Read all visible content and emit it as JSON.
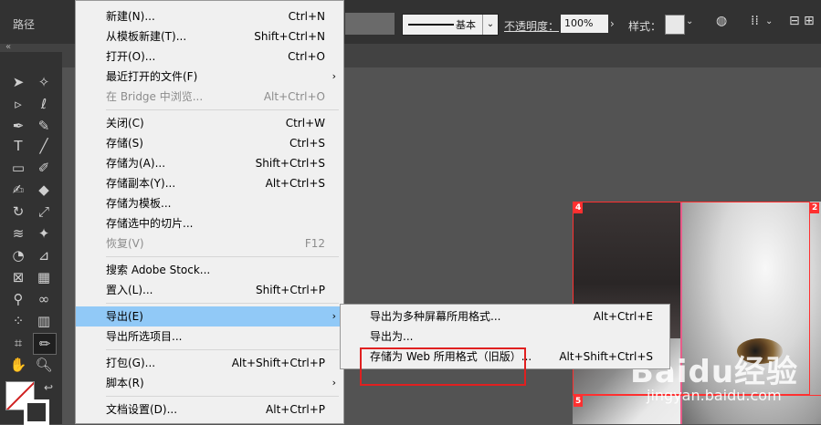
{
  "topbar": {
    "title": "路径",
    "stroke_label": "基本",
    "opacity_label": "不透明度：",
    "opacity_value": "100%",
    "style_label": "样式："
  },
  "file_menu": [
    {
      "label": "新建(N)...",
      "shortcut": "Ctrl+N"
    },
    {
      "label": "从模板新建(T)...",
      "shortcut": "Shift+Ctrl+N"
    },
    {
      "label": "打开(O)...",
      "shortcut": "Ctrl+O"
    },
    {
      "label": "最近打开的文件(F)",
      "shortcut": "",
      "arrow": "›"
    },
    {
      "label": "在 Bridge 中浏览...",
      "shortcut": "Alt+Ctrl+O"
    },
    {
      "label": "关闭(C)",
      "shortcut": "Ctrl+W"
    },
    {
      "label": "存储(S)",
      "shortcut": "Ctrl+S"
    },
    {
      "label": "存储为(A)...",
      "shortcut": "Shift+Ctrl+S"
    },
    {
      "label": "存储副本(Y)...",
      "shortcut": "Alt+Ctrl+S"
    },
    {
      "label": "存储为模板...",
      "shortcut": ""
    },
    {
      "label": "存储选中的切片...",
      "shortcut": ""
    },
    {
      "label": "恢复(V)",
      "shortcut": "F12"
    },
    {
      "label": "搜索 Adobe Stock...",
      "shortcut": ""
    },
    {
      "label": "置入(L)...",
      "shortcut": "Shift+Ctrl+P"
    },
    {
      "label": "导出(E)",
      "shortcut": "",
      "arrow": "›"
    },
    {
      "label": "导出所选项目...",
      "shortcut": ""
    },
    {
      "label": "打包(G)...",
      "shortcut": "Alt+Shift+Ctrl+P"
    },
    {
      "label": "脚本(R)",
      "shortcut": "",
      "arrow": "›"
    },
    {
      "label": "文档设置(D)...",
      "shortcut": "Alt+Ctrl+P"
    }
  ],
  "export_submenu": [
    {
      "label": "导出为多种屏幕所用格式...",
      "shortcut": "Alt+Ctrl+E"
    },
    {
      "label": "导出为...",
      "shortcut": ""
    },
    {
      "label": "存储为 Web 所用格式（旧版）...",
      "shortcut": "Alt+Shift+Ctrl+S"
    }
  ],
  "slices": [
    "4",
    "2",
    "5"
  ],
  "watermark": {
    "brand": "Baidu经验",
    "url": "jingyan.baidu.com"
  },
  "colors": {
    "highlight": "#91c9f7",
    "annotation": "#e02020",
    "slice": "#ff3030"
  }
}
